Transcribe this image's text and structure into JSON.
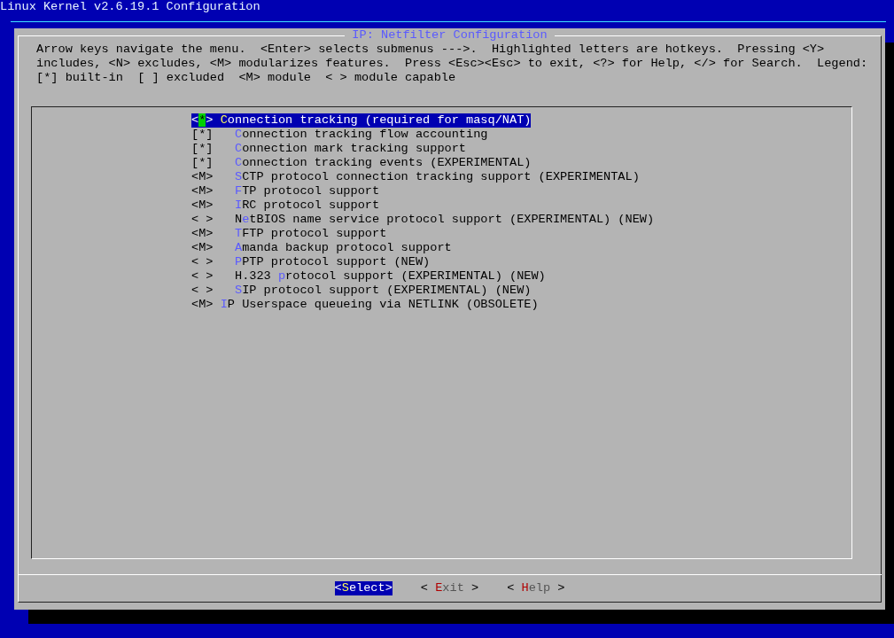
{
  "window": {
    "title": "Linux Kernel v2.6.19.1 Configuration"
  },
  "dialog": {
    "title": "IP: Netfilter Configuration",
    "help_lines": [
      "Arrow keys navigate the menu.  <Enter> selects submenus --->.  Highlighted letters are hotkeys.  Pressing <Y>",
      "includes, <N> excludes, <M> modularizes features.  Press <Esc><Esc> to exit, <?> for Help, </> for Search.  Legend:",
      "[*] built-in  [ ] excluded  <M> module  < > module capable"
    ],
    "menu": [
      {
        "marker": "<*>",
        "hotkey": "C",
        "after": "onnection tracking (required for masq/NAT)",
        "selected": true,
        "children": [
          {
            "marker": "[*]",
            "hotkey": "C",
            "after": "onnection tracking flow accounting",
            "selected": false
          },
          {
            "marker": "[*]",
            "hotkey": "C",
            "after": "onnection mark tracking support",
            "selected": false
          },
          {
            "marker": "[*]",
            "hotkey": "C",
            "after": "onnection tracking events (EXPERIMENTAL)",
            "selected": false
          },
          {
            "marker": "<M>",
            "hotkey": "S",
            "after": "CTP protocol connection tracking support (EXPERIMENTAL)",
            "selected": false
          },
          {
            "marker": "<M>",
            "hotkey": "F",
            "after": "TP protocol support",
            "selected": false
          },
          {
            "marker": "<M>",
            "hotkey": "I",
            "after": "RC protocol support",
            "selected": false
          },
          {
            "marker": "< >",
            "before": "N",
            "hotkey": "e",
            "after": "tBIOS name service protocol support (EXPERIMENTAL) (NEW)",
            "selected": false
          },
          {
            "marker": "<M>",
            "hotkey": "T",
            "after": "FTP protocol support",
            "selected": false
          },
          {
            "marker": "<M>",
            "hotkey": "A",
            "after": "manda backup protocol support",
            "selected": false
          },
          {
            "marker": "< >",
            "hotkey": "P",
            "after": "PTP protocol support (NEW)",
            "selected": false
          },
          {
            "marker": "< >",
            "before": "H.323 ",
            "hotkey": "p",
            "after": "rotocol support (EXPERIMENTAL) (NEW)",
            "selected": false
          },
          {
            "marker": "< >",
            "hotkey": "S",
            "after": "IP protocol support (EXPERIMENTAL) (NEW)",
            "selected": false
          }
        ]
      },
      {
        "marker": "<M>",
        "hotkey": "I",
        "after": "P Userspace queueing via NETLINK (OBSOLETE)",
        "selected": false
      }
    ],
    "buttons": [
      {
        "before": "<",
        "hotkey": "S",
        "after": "elect>",
        "selected": true
      },
      {
        "before": "< ",
        "hotkey": "E",
        "after": "xit >",
        "selected": false
      },
      {
        "before": "< ",
        "hotkey": "H",
        "after": "elp >",
        "selected": false
      }
    ]
  }
}
